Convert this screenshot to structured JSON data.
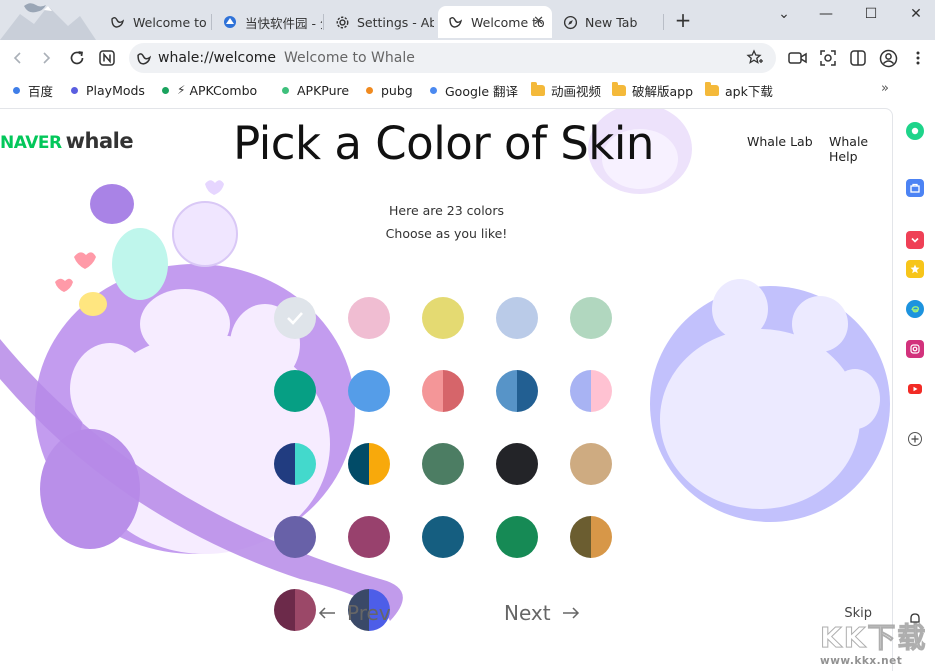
{
  "tabs": [
    {
      "title": "Welcome to Whale",
      "icon": "whale-icon",
      "active": false
    },
    {
      "title": "当快软件园 - 分享",
      "icon": "dangkuai-icon",
      "active": false
    },
    {
      "title": "Settings - About",
      "icon": "gear-icon",
      "active": false
    },
    {
      "title": "Welcome to",
      "icon": "whale-icon",
      "active": true
    },
    {
      "title": "New Tab",
      "icon": "compass-icon",
      "active": false
    }
  ],
  "window_controls": {
    "dropdown": "⌄",
    "minimize": "—",
    "maximize": "☐",
    "close": "✕"
  },
  "address_bar": {
    "url": "whale://welcome",
    "page_title": "Welcome to Whale"
  },
  "bookmarks": [
    {
      "label": "百度",
      "kind": "dot",
      "color": "#3f7ee8"
    },
    {
      "label": "PlayMods",
      "kind": "dot",
      "color": "#5a5ee0"
    },
    {
      "label": "APKCombo",
      "kind": "bolt",
      "color": "#1aa35e"
    },
    {
      "label": "APKPure",
      "kind": "dot",
      "color": "#3ec07c"
    },
    {
      "label": "pubg",
      "kind": "dot",
      "color": "#f08a1f"
    },
    {
      "label": "Google 翻译",
      "kind": "dot",
      "color": "#4b89f0"
    },
    {
      "label": "动画视频",
      "kind": "folder",
      "color": "#f4b93a"
    },
    {
      "label": "破解版app",
      "kind": "folder",
      "color": "#f4b93a"
    },
    {
      "label": "apk下载",
      "kind": "folder",
      "color": "#f4b93a"
    }
  ],
  "bookmarks_more": "»",
  "brand": {
    "naver": "NAVER",
    "whale": "whale"
  },
  "top_links": {
    "lab": "Whale Lab",
    "help": "Whale Help"
  },
  "headline": "Pick a Color of Skin",
  "subtitle": {
    "line1": "Here are 23 colors",
    "line2": "Choose as you like!"
  },
  "swatches": [
    {
      "left": "#dfe4ea",
      "right": "#dfe4ea",
      "selected": true
    },
    {
      "left": "#f0bdd2",
      "right": "#f0bdd2"
    },
    {
      "left": "#e4da72",
      "right": "#e4da72"
    },
    {
      "left": "#bacbe8",
      "right": "#bacbe8"
    },
    {
      "left": "#b1d7bf",
      "right": "#b1d7bf"
    },
    {
      "left": "#069f84",
      "right": "#069f84"
    },
    {
      "left": "#559de8",
      "right": "#559de8"
    },
    {
      "left": "#f49698",
      "right": "#d6656a"
    },
    {
      "left": "#5794c8",
      "right": "#225f92"
    },
    {
      "left": "#a8b3f3",
      "right": "#ffc2d2"
    },
    {
      "left": "#213c80",
      "right": "#43d9cc"
    },
    {
      "left": "#014b67",
      "right": "#f8a90b"
    },
    {
      "left": "#4c7d63",
      "right": "#4c7d63"
    },
    {
      "left": "#232428",
      "right": "#232428"
    },
    {
      "left": "#ceab81",
      "right": "#ceab81"
    },
    {
      "left": "#6861a8",
      "right": "#6861a8"
    },
    {
      "left": "#98416d",
      "right": "#98416d"
    },
    {
      "left": "#155e80",
      "right": "#155e80"
    },
    {
      "left": "#168a55",
      "right": "#168a55"
    },
    {
      "left": "#6b5d30",
      "right": "#d79748"
    },
    {
      "left": "#6c2a4a",
      "right": "#9b4868"
    },
    {
      "left": "#3a4968",
      "right": "#4d5ee8"
    }
  ],
  "nav": {
    "prev": "Prev",
    "next": "Next",
    "skip": "Skip"
  },
  "sidebar": [
    {
      "name": "whale-space-icon",
      "color": "#1ed48a"
    },
    {
      "name": "store-icon",
      "color": "#4c83f4"
    },
    {
      "name": "pocket-icon",
      "color": "#ef4056"
    },
    {
      "name": "favorites-icon",
      "color": "#f7c51a"
    },
    {
      "name": "edge-icon",
      "color": "#1d93de"
    },
    {
      "name": "instagram-icon",
      "color": "#d2327c"
    },
    {
      "name": "youtube-icon",
      "color": "#f22b25"
    },
    {
      "name": "add-icon",
      "color": "#444444"
    }
  ],
  "watermark": {
    "text": "KK下载",
    "url": "www.kkx.net"
  }
}
